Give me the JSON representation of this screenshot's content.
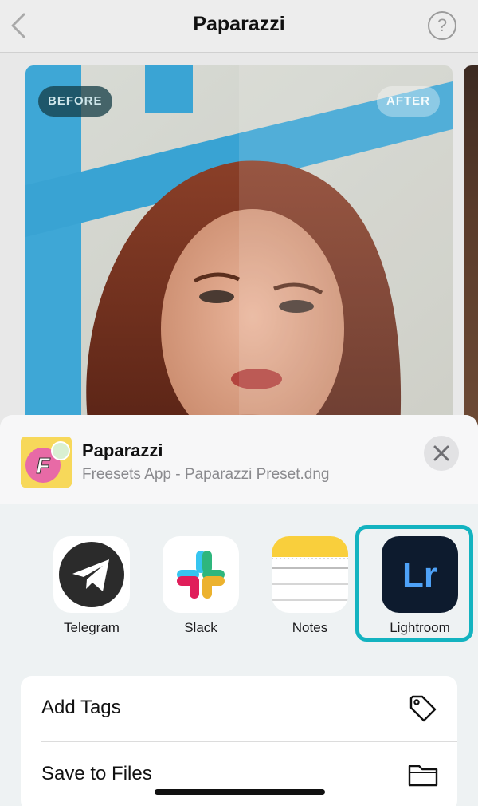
{
  "header": {
    "title": "Paparazzi",
    "back_icon": "chevron-left-icon",
    "help_label": "?"
  },
  "photo": {
    "before_label": "BEFORE",
    "after_label": "AFTER"
  },
  "share_sheet": {
    "file_title": "Paparazzi",
    "file_subtitle": "Freesets App - Paparazzi Preset.dng",
    "thumb_letter": "F",
    "apps": [
      {
        "label": "Telegram",
        "icon": "telegram-icon"
      },
      {
        "label": "Slack",
        "icon": "slack-icon"
      },
      {
        "label": "Notes",
        "icon": "notes-icon"
      },
      {
        "label": "Lightroom",
        "icon": "lightroom-icon",
        "icon_text": "Lr",
        "highlighted": true
      }
    ],
    "actions": [
      {
        "label": "Add Tags",
        "icon": "tag-icon"
      },
      {
        "label": "Save to Files",
        "icon": "folder-icon"
      }
    ]
  },
  "colors": {
    "highlight": "#13b3c0",
    "lightroom_bg": "#0d1b2e",
    "lightroom_text": "#4ea2f7",
    "notes_yellow": "#f9cf3c"
  }
}
